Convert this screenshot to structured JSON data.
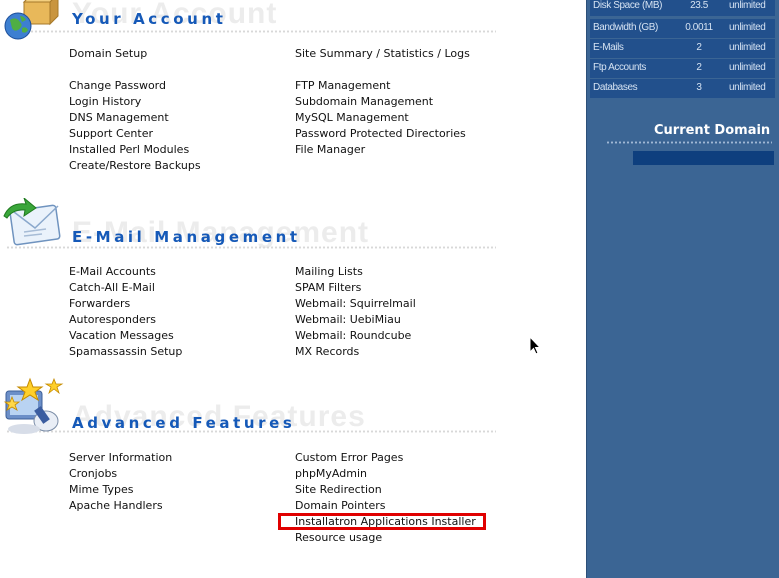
{
  "sections": {
    "account": {
      "title": "Your Account",
      "ghost": "Your Account",
      "left": [
        "Domain Setup",
        "Change Password",
        "Login History",
        "DNS Management",
        "Support Center",
        "Installed Perl Modules",
        "Create/Restore Backups"
      ],
      "right": [
        "Site Summary / Statistics / Logs",
        "FTP Management",
        "Subdomain Management",
        "MySQL Management",
        "Password Protected Directories",
        "File Manager"
      ]
    },
    "email": {
      "title": "E-Mail Management",
      "ghost": "E-Mail Management",
      "left": [
        "E-Mail Accounts",
        "Catch-All E-Mail",
        "Forwarders",
        "Autoresponders",
        "Vacation Messages",
        "Spamassassin Setup"
      ],
      "right": [
        "Mailing Lists",
        "SPAM Filters",
        "Webmail: Squirrelmail",
        "Webmail: UebiMiau",
        "Webmail: Roundcube",
        "MX Records"
      ]
    },
    "advanced": {
      "title": "Advanced Features",
      "ghost": "Advanced Features",
      "left": [
        "Server Information",
        "Cronjobs",
        "Mime Types",
        "Apache Handlers"
      ],
      "right": [
        "Custom Error Pages",
        "phpMyAdmin",
        "Site Redirection",
        "Domain Pointers",
        "Installatron Applications Installer",
        "Resource usage"
      ]
    }
  },
  "stats": [
    {
      "label": "Disk Space (MB)",
      "used": "23.5",
      "limit": "unlimited"
    },
    {
      "label": "Bandwidth (GB)",
      "used": "0.0011",
      "limit": "unlimited"
    },
    {
      "label": "E-Mails",
      "used": "2",
      "limit": "unlimited"
    },
    {
      "label": "Ftp Accounts",
      "used": "2",
      "limit": "unlimited"
    },
    {
      "label": "Databases",
      "used": "3",
      "limit": "unlimited"
    }
  ],
  "sidebar": {
    "current_domain_title": "Current Domain"
  },
  "highlight": {
    "item": "Installatron Applications Installer",
    "color": "#e00000"
  },
  "colors": {
    "title_blue": "#1559b8",
    "sidebar_bg": "#3b6594",
    "stat_bg": "#22508c"
  }
}
